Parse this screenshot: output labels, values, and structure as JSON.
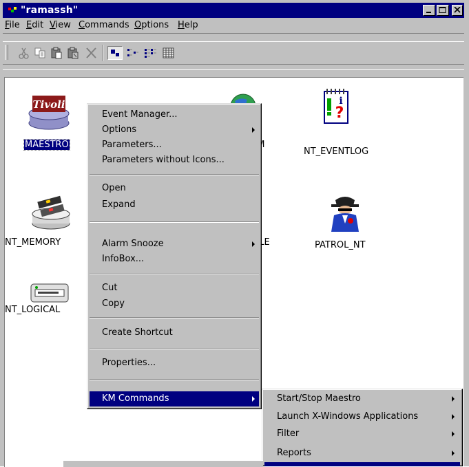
{
  "window": {
    "title": "\"ramassh\"",
    "controls": [
      "minimize",
      "maximize",
      "close"
    ]
  },
  "menubar": {
    "items": [
      {
        "label": "File",
        "mnemonic": "F"
      },
      {
        "label": "Edit",
        "mnemonic": "E"
      },
      {
        "label": "View",
        "mnemonic": "V"
      },
      {
        "label": "Commands",
        "mnemonic": "C"
      },
      {
        "label": "Options",
        "mnemonic": "O"
      },
      {
        "label": "Help",
        "mnemonic": "H"
      }
    ]
  },
  "toolbar": {
    "buttons": [
      "cut-icon",
      "copy-icon",
      "paste-icon",
      "paste-special-icon",
      "delete-icon",
      "large-icons-view-icon",
      "small-icons-view-icon",
      "list-view-icon",
      "details-view-icon"
    ]
  },
  "icons": [
    {
      "label": "MAESTRO",
      "icon": "tivoli-icon",
      "logo_text": "Tivoli",
      "selected": true
    },
    {
      "label": "NT_MEMORY",
      "icon": "memory-chip-icon"
    },
    {
      "label": "NT_LOGICAL",
      "icon": "disk-drive-icon"
    },
    {
      "label": "EM",
      "icon": "globe-icon"
    },
    {
      "label": "FILE",
      "icon": "folder-icon"
    },
    {
      "label": "NT_EVENTLOG",
      "icon": "eventlog-icon"
    },
    {
      "label": "PATROL_NT",
      "icon": "patrol-agent-icon"
    }
  ],
  "context_menu": {
    "items": [
      "Event Manager...",
      "Options",
      "Parameters...",
      "Parameters without Icons...",
      "Open",
      "Expand",
      "Alarm Snooze",
      "InfoBox...",
      "Cut",
      "Copy",
      "Create Shortcut",
      "Properties...",
      "KM Commands"
    ],
    "highlighted": "KM Commands"
  },
  "submenu": {
    "items": [
      "Start/Stop Maestro",
      "Launch X-Windows Applications",
      "Filter",
      "Reports"
    ]
  },
  "colors": {
    "titlebar": "#000080",
    "highlight": "#000080",
    "chrome": "#c0c0c0"
  }
}
